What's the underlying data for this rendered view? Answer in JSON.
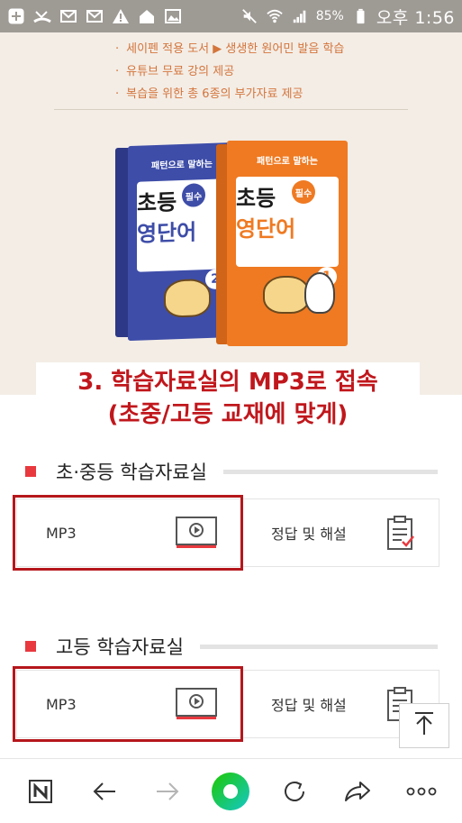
{
  "status_bar": {
    "battery_percent": "85%",
    "time": "오후 1:56",
    "left_icons": [
      "plus-icon",
      "missed-call-icon",
      "mail-icon",
      "mail-icon",
      "warning-icon",
      "home-app-icon",
      "image-icon"
    ],
    "right_icons": [
      "mute-icon",
      "wifi-icon",
      "signal-icon",
      "battery-icon"
    ]
  },
  "banner": {
    "bullets": [
      "세이펜 적용 도서 ▶ 생생한 원어민 발음 학습",
      "유튜브 무료 강의 제공",
      "복습을 위한 총 6종의 부가자료 제공"
    ],
    "bullet_marker": "·",
    "books": [
      {
        "tagline": "패턴으로 말하는",
        "title_a": "초등",
        "badge": "필수",
        "title_b": "영단어",
        "volume": "2",
        "color": "#3e4da8"
      },
      {
        "tagline": "패턴으로 말하는",
        "title_a": "초등",
        "badge": "필수",
        "title_b": "영단어",
        "volume": "1",
        "color": "#ef7a22"
      }
    ]
  },
  "caption": {
    "line1": "3. 학습자료실의 MP3로 접속",
    "line2": "(초중/고등 교재에 맞게)",
    "color": "#c0171c"
  },
  "sections": [
    {
      "title": "초·중등 학습자료실",
      "cards": [
        {
          "label": "MP3",
          "icon": "video-player-icon"
        },
        {
          "label": "정답 및 해설",
          "icon": "clipboard-answer-icon"
        }
      ]
    },
    {
      "title": "고등 학습자료실",
      "cards": [
        {
          "label": "MP3",
          "icon": "video-player-icon"
        },
        {
          "label": "정답 및 해설",
          "icon": "clipboard-answer-icon"
        }
      ]
    }
  ],
  "colors": {
    "accent_red": "#e8393f",
    "highlight_border": "#b5171c",
    "banner_bg": "#f3ede6",
    "bullet_text": "#d4753c",
    "naver_green": "#1ec800"
  },
  "bottom_nav": {
    "items": [
      "naver-home-icon",
      "back-arrow-icon",
      "forward-arrow-icon",
      "naver-green-dot-icon",
      "refresh-icon",
      "share-icon",
      "more-icon"
    ]
  }
}
